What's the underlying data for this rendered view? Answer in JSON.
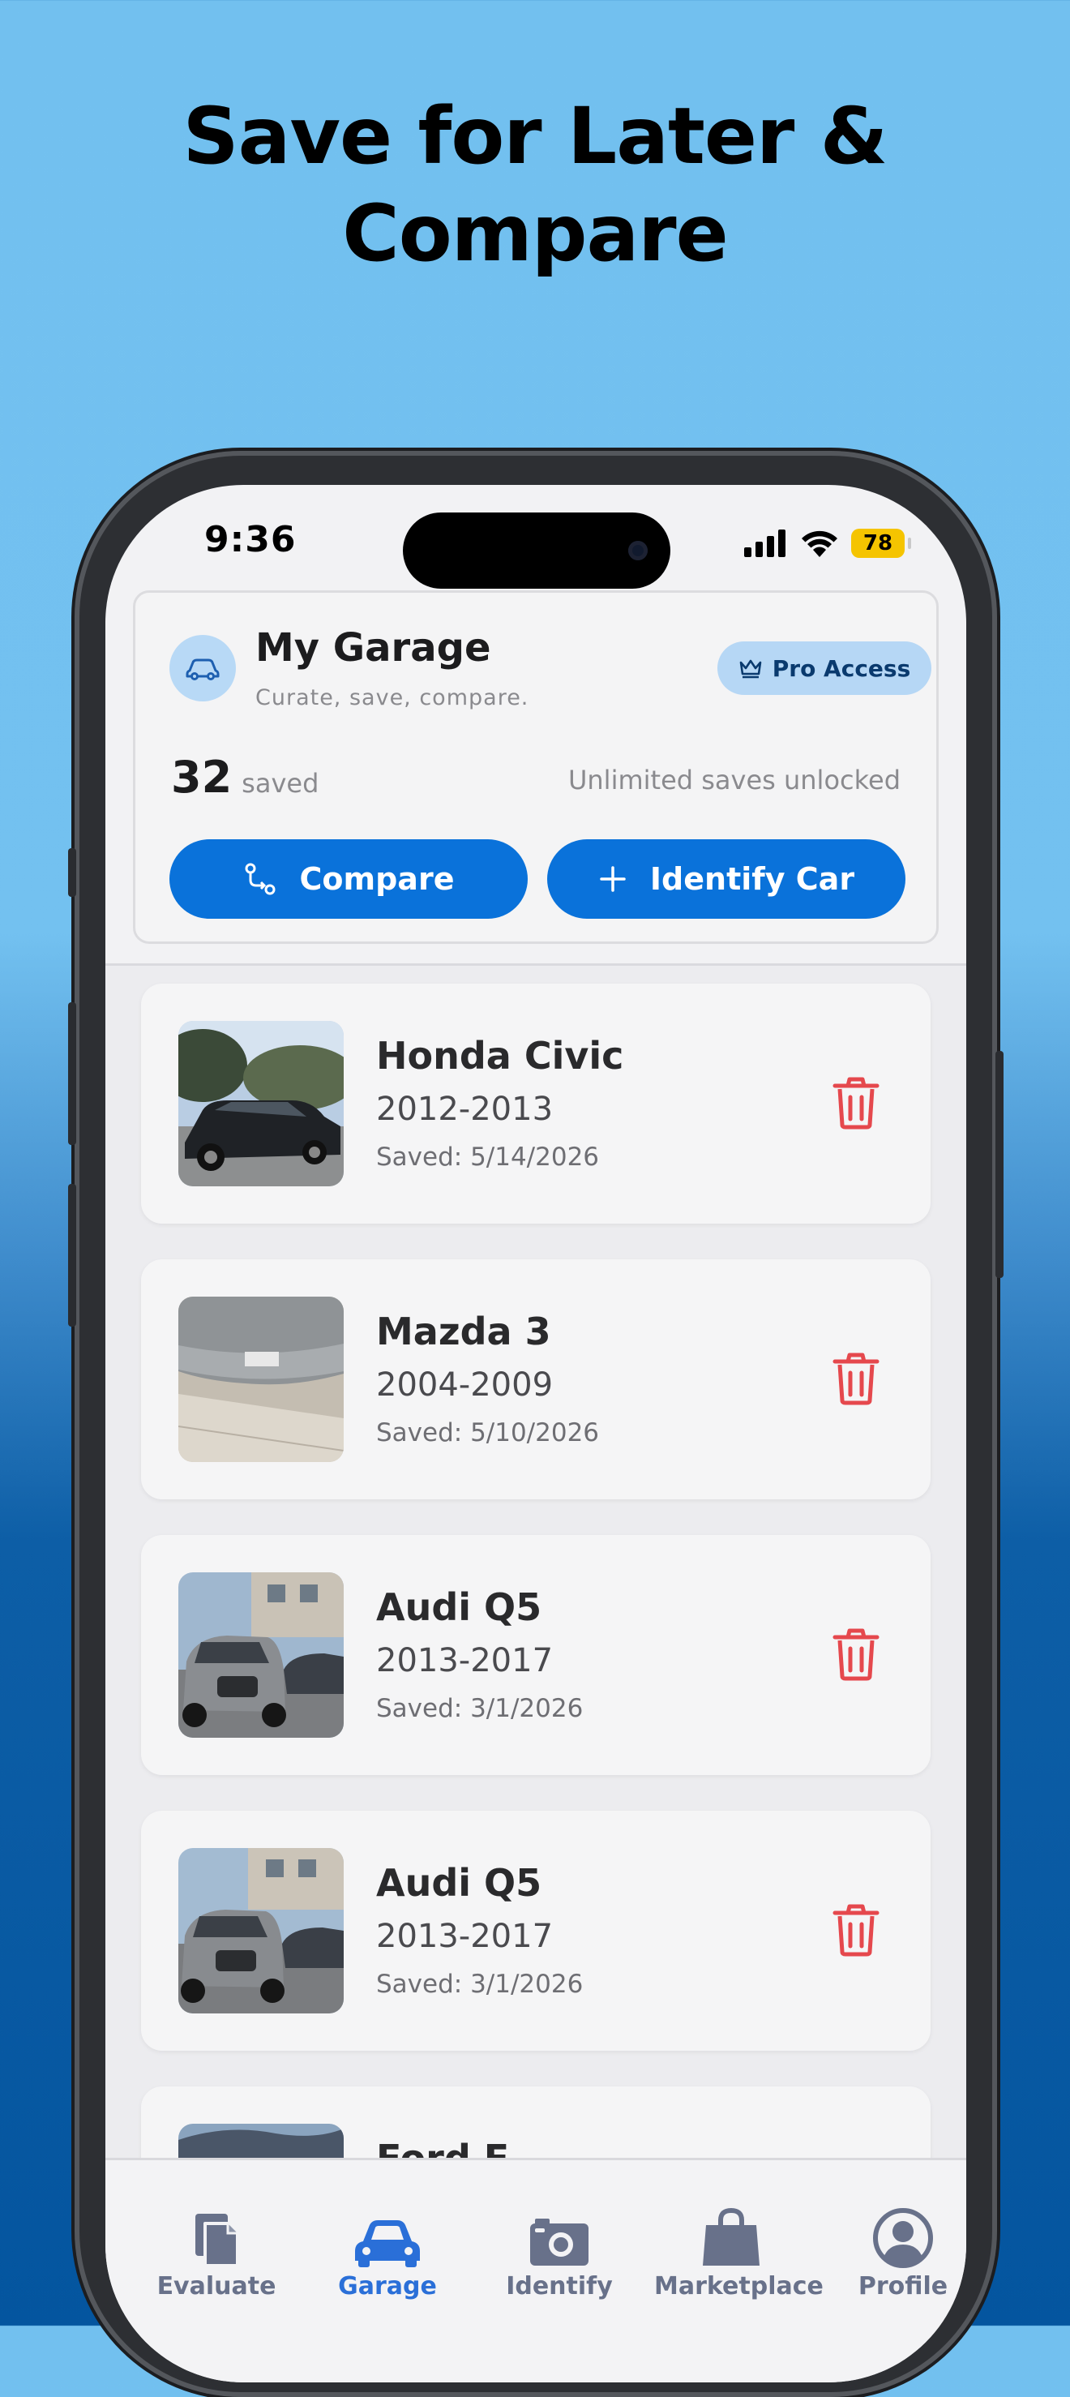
{
  "headline": {
    "line1": "Save for Later &",
    "line2": "Compare"
  },
  "status_bar": {
    "time": "9:36",
    "battery": "78"
  },
  "header": {
    "title": "My Garage",
    "subtitle": "Curate, save, compare.",
    "badge": "Pro Access",
    "saved_count": "32",
    "saved_label": "saved",
    "unlimited_text": "Unlimited saves unlocked",
    "compare_label": "Compare",
    "identify_label": "Identify Car"
  },
  "cars": [
    {
      "name": "Honda Civic",
      "years": "2012-2013",
      "saved": "Saved: 5/14/2026"
    },
    {
      "name": "Mazda 3",
      "years": "2004-2009",
      "saved": "Saved: 5/10/2026"
    },
    {
      "name": "Audi Q5",
      "years": "2013-2017",
      "saved": "Saved: 3/1/2026"
    },
    {
      "name": "Audi Q5",
      "years": "2013-2017",
      "saved": "Saved: 3/1/2026"
    },
    {
      "name": "Ford E...",
      "years": "",
      "saved": ""
    }
  ],
  "tabs": [
    {
      "label": "Evaluate",
      "icon": "document-icon"
    },
    {
      "label": "Garage",
      "icon": "car-icon",
      "active": true
    },
    {
      "label": "Identify",
      "icon": "camera-icon"
    },
    {
      "label": "Marketplace",
      "icon": "shopping-bag-icon"
    },
    {
      "label": "Profile",
      "icon": "profile-icon"
    }
  ],
  "colors": {
    "accent": "#0a72da",
    "delete": "#e5484d",
    "tab_active": "#2a6fd8",
    "tab_inactive": "#68718a",
    "badge_bg": "#b6d7f5"
  }
}
